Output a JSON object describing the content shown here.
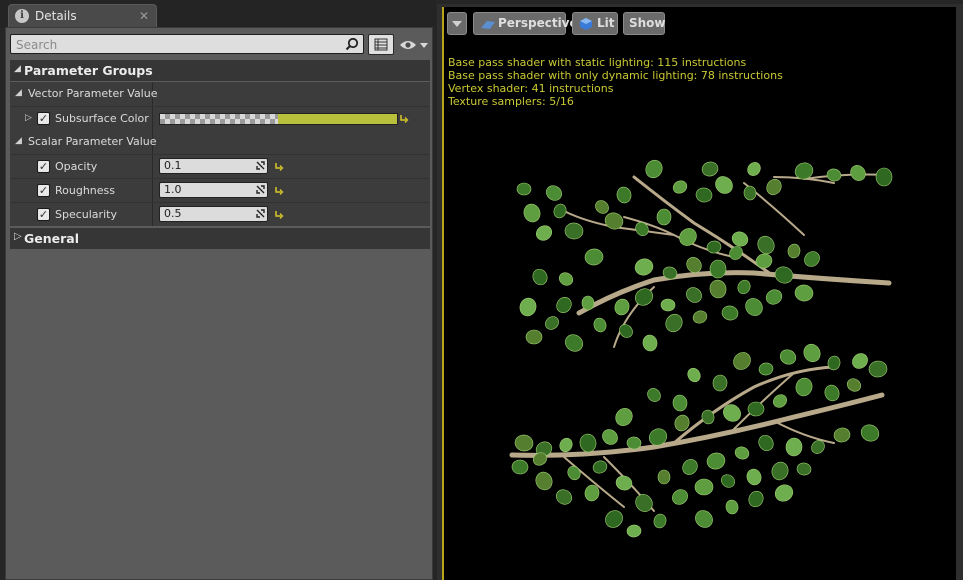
{
  "details_tab": {
    "title": "Details"
  },
  "search": {
    "placeholder": "Search"
  },
  "parameter_groups": {
    "header": "Parameter Groups",
    "vector_group": {
      "label": "Vector Parameter Value",
      "items": [
        {
          "name": "Subsurface Color",
          "checked": true
        }
      ]
    },
    "scalar_group": {
      "label": "Scalar Parameter Value",
      "items": [
        {
          "name": "Opacity",
          "value": "0.1",
          "checked": true
        },
        {
          "name": "Roughness",
          "value": "1.0",
          "checked": true
        },
        {
          "name": "Specularity",
          "value": "0.5",
          "checked": true
        }
      ]
    }
  },
  "general": {
    "header": "General"
  },
  "viewport": {
    "perspective_label": "Perspective",
    "lit_label": "Lit",
    "show_label": "Show",
    "stats": [
      "Base pass shader with static lighting: 115 instructions",
      "Base pass shader with only dynamic lighting: 78 instructions",
      "Vertex shader: 41 instructions",
      "Texture samplers: 5/16"
    ]
  },
  "colors": {
    "subsurface_color": "#b9c03c",
    "stats_text": "#c9c936",
    "viewport_border": "#b8a31a"
  }
}
